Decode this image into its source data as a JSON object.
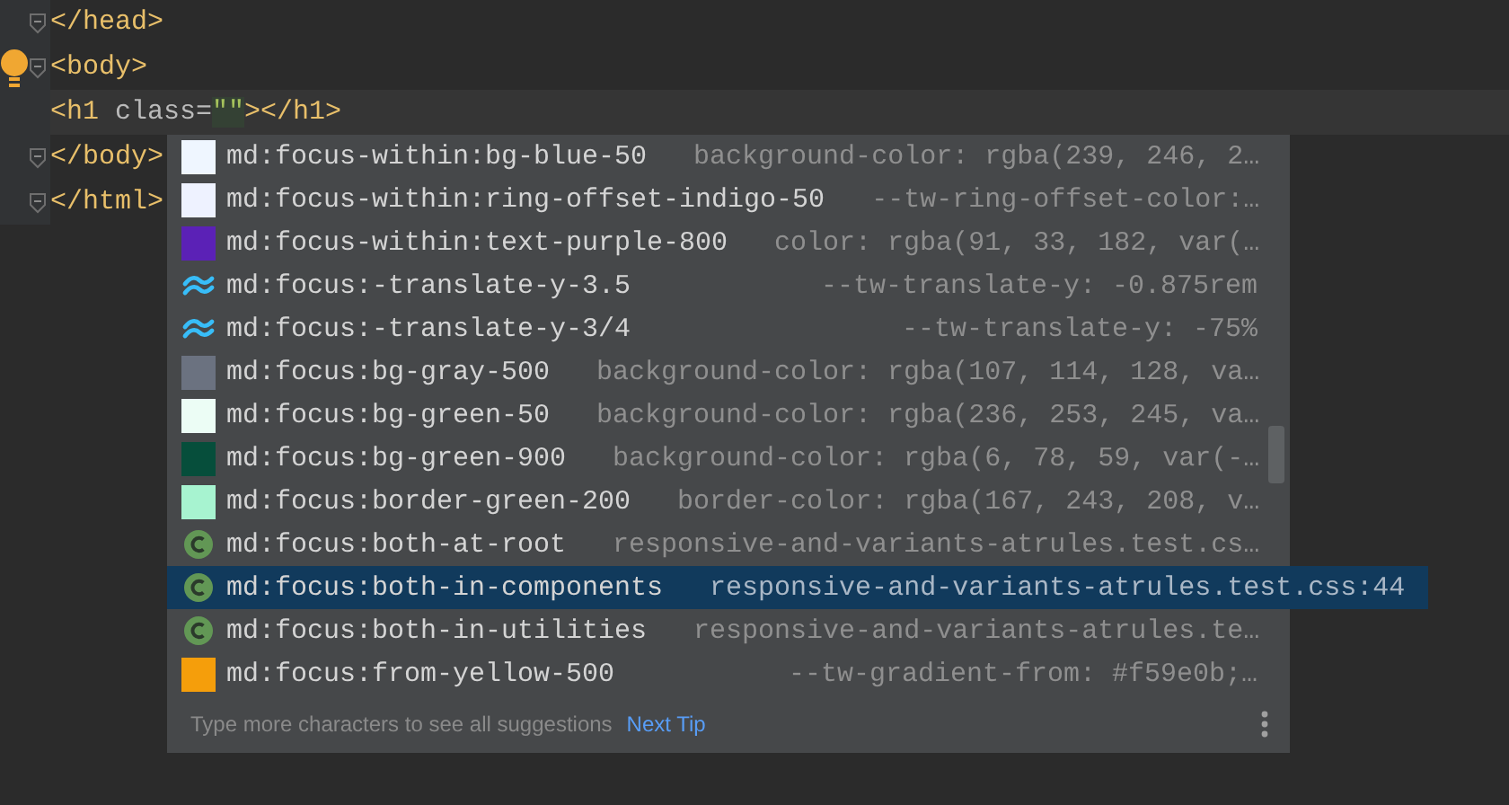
{
  "editor": {
    "lines": [
      {
        "fold": true,
        "current": false,
        "bulb": false,
        "tokens": [
          {
            "kind": "tag",
            "text": "</head>"
          }
        ]
      },
      {
        "fold": true,
        "current": false,
        "bulb": true,
        "tokens": [
          {
            "kind": "tag",
            "text": "<body>"
          }
        ]
      },
      {
        "fold": false,
        "current": true,
        "bulb": false,
        "tokens": [
          {
            "kind": "tag",
            "text": "<h1 "
          },
          {
            "kind": "attr",
            "text": "class="
          },
          {
            "kind": "string",
            "text": "\"\""
          },
          {
            "kind": "tag",
            "text": "></h1>"
          }
        ]
      },
      {
        "fold": true,
        "current": false,
        "bulb": false,
        "tokens": [
          {
            "kind": "tag",
            "text": "</body>"
          }
        ]
      },
      {
        "fold": true,
        "current": false,
        "bulb": false,
        "tokens": [
          {
            "kind": "tag",
            "text": "</html>"
          }
        ]
      }
    ]
  },
  "completion": {
    "items": [
      {
        "kind": "swatch",
        "color": "#eff6ff",
        "name": "md:focus-within:bg-blue-50",
        "detail": "background-color: rgba(239, 246, 2…",
        "selected": false
      },
      {
        "kind": "swatch",
        "color": "#eef2ff",
        "name": "md:focus-within:ring-offset-indigo-50",
        "detail": "--tw-ring-offset-color:…",
        "selected": false
      },
      {
        "kind": "swatch",
        "color": "#5b21b6",
        "name": "md:focus-within:text-purple-800",
        "detail": "color: rgba(91, 33, 182, var(…",
        "selected": false
      },
      {
        "kind": "tailwind",
        "name": "md:focus:-translate-y-3.5",
        "detail": "--tw-translate-y: -0.875rem",
        "selected": false
      },
      {
        "kind": "tailwind",
        "name": "md:focus:-translate-y-3/4",
        "detail": "--tw-translate-y: -75%",
        "selected": false
      },
      {
        "kind": "swatch",
        "color": "#6b7280",
        "name": "md:focus:bg-gray-500",
        "detail": "background-color: rgba(107, 114, 128, va…",
        "selected": false
      },
      {
        "kind": "swatch",
        "color": "#ecfdf5",
        "name": "md:focus:bg-green-50",
        "detail": "background-color: rgba(236, 253, 245, va…",
        "selected": false
      },
      {
        "kind": "swatch",
        "color": "#064e3b",
        "name": "md:focus:bg-green-900",
        "detail": "background-color: rgba(6, 78, 59, var(-…",
        "selected": false
      },
      {
        "kind": "swatch",
        "color": "#a7f3d0",
        "name": "md:focus:border-green-200",
        "detail": "border-color: rgba(167, 243, 208, v…",
        "selected": false
      },
      {
        "kind": "class",
        "name": "md:focus:both-at-root",
        "detail": "responsive-and-variants-atrules.test.cs…",
        "selected": false
      },
      {
        "kind": "class",
        "name": "md:focus:both-in-components",
        "detail": "responsive-and-variants-atrules.test.css:44",
        "selected": true
      },
      {
        "kind": "class",
        "name": "md:focus:both-in-utilities",
        "detail": "responsive-and-variants-atrules.te…",
        "selected": false
      },
      {
        "kind": "swatch",
        "color": "#f59e0b",
        "name": "md:focus:from-yellow-500",
        "detail": "--tw-gradient-from: #f59e0b;…",
        "selected": false
      }
    ],
    "hint": "Type more characters to see all suggestions",
    "next_tip": "Next Tip"
  }
}
